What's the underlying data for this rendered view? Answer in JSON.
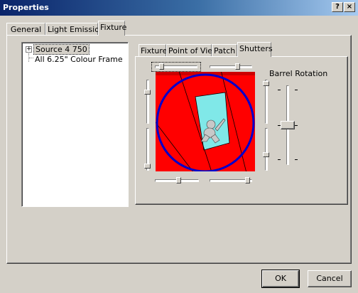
{
  "window": {
    "title": "Properties",
    "help_btn": "?",
    "close_btn": "×"
  },
  "outer_tabs": [
    {
      "label": "General"
    },
    {
      "label": "Light Emission"
    },
    {
      "label": "Fixture"
    }
  ],
  "tree": {
    "expander": "+",
    "items": [
      {
        "label": "Source 4 750"
      },
      {
        "label": "All 6.25\" Colour Frame"
      }
    ]
  },
  "inner_tabs": [
    {
      "label": "Fixture"
    },
    {
      "label": "Point of View"
    },
    {
      "label": "Patch"
    },
    {
      "label": "Shutters"
    }
  ],
  "shutters": {
    "barrel_rotation_label": "Barrel Rotation",
    "beam_color": "#ff0000",
    "circle_color": "#0000cc",
    "opening_color": "#80e8e8"
  },
  "buttons": {
    "ok": "OK",
    "cancel": "Cancel"
  }
}
